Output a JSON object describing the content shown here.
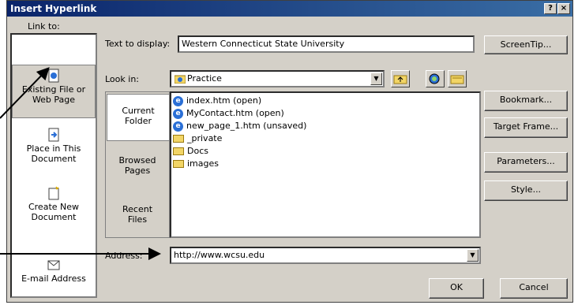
{
  "dialog": {
    "title": "Insert Hyperlink",
    "help_button": "?",
    "close_button": "×"
  },
  "link_to": {
    "header": "Link to:",
    "items": [
      {
        "line1": "Existing File or",
        "line2": "Web Page",
        "icon": "existing-file-icon"
      },
      {
        "line1": "Place in This",
        "line2": "Document",
        "icon": "place-in-document-icon"
      },
      {
        "line1": "Create New",
        "line2": "Document",
        "icon": "new-document-icon"
      },
      {
        "line1": "E-mail Address",
        "line2": "",
        "icon": "email-icon"
      }
    ]
  },
  "text_to_display": {
    "label": "Text to display:",
    "value": "Western Connecticut State University"
  },
  "look_in": {
    "label": "Look in:",
    "value": "Practice"
  },
  "side_tabs": [
    {
      "line1": "Current",
      "line2": "Folder"
    },
    {
      "line1": "Browsed",
      "line2": "Pages"
    },
    {
      "line1": "Recent",
      "line2": "Files"
    }
  ],
  "files": [
    {
      "name": "index.htm (open)",
      "type": "ie"
    },
    {
      "name": "MyContact.htm (open)",
      "type": "ie"
    },
    {
      "name": "new_page_1.htm (unsaved)",
      "type": "ie"
    },
    {
      "name": "_private",
      "type": "folder"
    },
    {
      "name": "Docs",
      "type": "folder"
    },
    {
      "name": "images",
      "type": "folder"
    }
  ],
  "address": {
    "label": "Address:",
    "value": "http://www.wcsu.edu"
  },
  "buttons": {
    "screentip": "ScreenTip...",
    "bookmark": "Bookmark...",
    "target_frame": "Target Frame...",
    "parameters": "Parameters...",
    "style": "Style...",
    "ok": "OK",
    "cancel": "Cancel"
  }
}
